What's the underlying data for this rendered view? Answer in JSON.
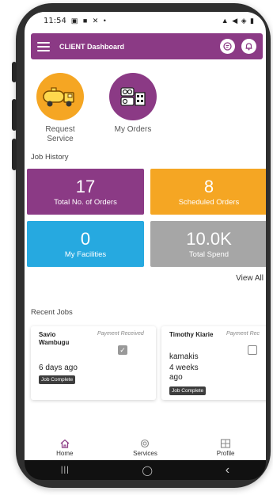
{
  "status_bar": {
    "time": "11:54",
    "left_icons": "▣ ■ ✕ •",
    "right_icons": "▲ ◀ ◈ ▮"
  },
  "header": {
    "title": "CLIENT Dashboard"
  },
  "quick_actions": [
    {
      "label": "Request Service",
      "icon": "truck-icon"
    },
    {
      "label": "My Orders",
      "icon": "orders-icon"
    }
  ],
  "job_history": {
    "title": "Job History",
    "stats": [
      {
        "value": "17",
        "label": "Total No. of Orders",
        "color": "#8b3a85"
      },
      {
        "value": "8",
        "label": "Scheduled  Orders",
        "color": "#f5a623"
      },
      {
        "value": "0",
        "label": "My Facilities",
        "color": "#26a9e0"
      },
      {
        "value": "10.0K",
        "label": "Total Spend",
        "color": "#a6a6a6"
      }
    ],
    "view_all": "View All"
  },
  "recent_jobs": {
    "title": "Recent Jobs",
    "jobs": [
      {
        "name": "Savio Wambugu",
        "payment_label": "Payment Received",
        "checked": true,
        "company": "",
        "ago": "6 days ago",
        "status": "Job Complete"
      },
      {
        "name": "Timothy Kiarie",
        "payment_label": "Payment Rec",
        "checked": false,
        "company": "kamakis",
        "ago": "4 weeks ago",
        "status": "Job Complete"
      }
    ]
  },
  "bottom_nav": [
    {
      "label": "Home",
      "icon": "home-icon"
    },
    {
      "label": "Services",
      "icon": "services-icon"
    },
    {
      "label": "Profile",
      "icon": "profile-icon"
    }
  ],
  "android_nav": {
    "recents": "|||",
    "home": "◯",
    "back": "‹"
  },
  "colors": {
    "primary": "#8b3a85",
    "accent": "#f5a623",
    "info": "#26a9e0",
    "muted": "#a6a6a6"
  }
}
